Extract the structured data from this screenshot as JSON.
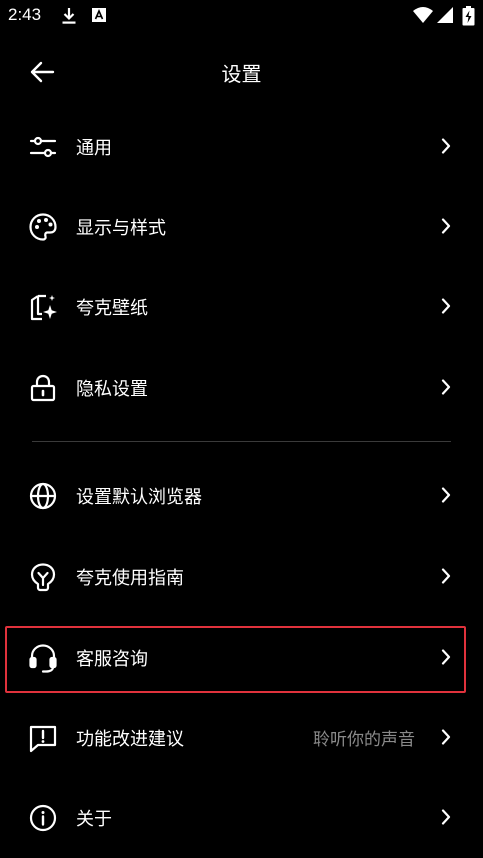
{
  "status_bar": {
    "time": "2:43",
    "left_icons": [
      "download-icon",
      "accessibility-font-icon"
    ],
    "right_icons": [
      "wifi-icon",
      "cellular-signal-icon",
      "battery-charging-icon"
    ]
  },
  "header": {
    "title": "设置",
    "back_icon": "arrow-left-icon"
  },
  "menu": {
    "items": [
      {
        "label": "通用",
        "icon": "sliders-icon"
      },
      {
        "label": "显示与样式",
        "icon": "palette-icon"
      },
      {
        "label": "夸克壁纸",
        "icon": "wallpaper-icon"
      },
      {
        "label": "隐私设置",
        "icon": "lock-icon"
      },
      {
        "label": "设置默认浏览器",
        "icon": "globe-icon"
      },
      {
        "label": "夸克使用指南",
        "icon": "lightbulb-icon"
      },
      {
        "label": "客服咨询",
        "icon": "headset-icon",
        "highlighted": true
      },
      {
        "label": "功能改进建议",
        "icon": "feedback-icon",
        "value": "聆听你的声音"
      },
      {
        "label": "关于",
        "icon": "info-icon"
      }
    ]
  },
  "colors": {
    "background": "#000000",
    "text": "#ffffff",
    "secondary_text": "#8a8a8a",
    "divider": "#3a3a3a",
    "highlight_border": "#e0323c"
  }
}
